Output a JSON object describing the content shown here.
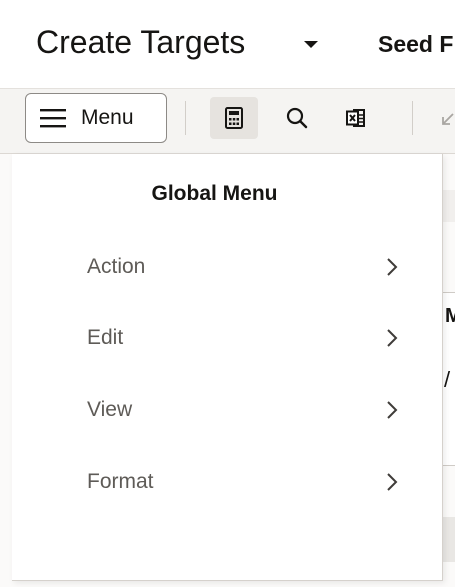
{
  "header": {
    "title": "Create Targets",
    "subtitle": "Seed F"
  },
  "toolbar": {
    "menu_label": "Menu",
    "icons": [
      "calculator-icon",
      "search-icon",
      "excel-icon",
      "arrow-icon"
    ]
  },
  "grid": {
    "column_header": "Ma",
    "cell_value": "/"
  },
  "global_menu": {
    "title": "Global Menu",
    "items": [
      {
        "label": "Action"
      },
      {
        "label": "Edit"
      },
      {
        "label": "View"
      },
      {
        "label": "Format"
      }
    ]
  },
  "colors": {
    "text": "#161513",
    "menu_item_text": "#5e5b57",
    "toolbar_bg": "#f5f4f2",
    "active_icon_bg": "#e6e3df"
  }
}
